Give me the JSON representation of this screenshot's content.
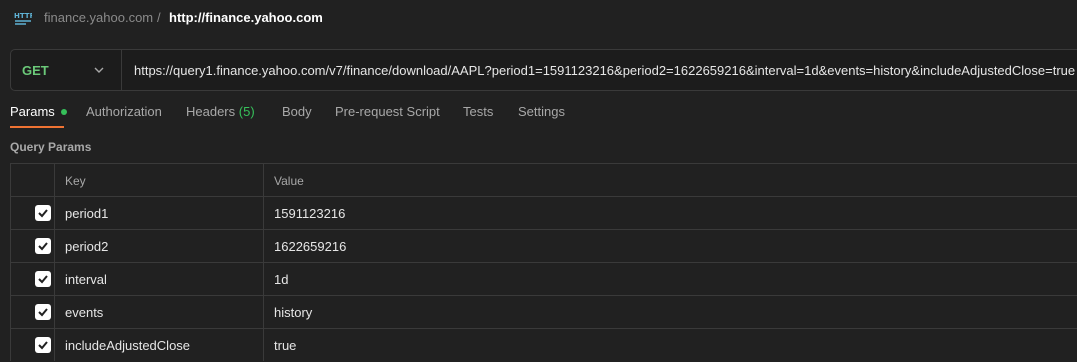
{
  "breadcrumb": {
    "parent": "finance.yahoo.com",
    "separator": "/",
    "current": "http://finance.yahoo.com"
  },
  "request": {
    "method": "GET",
    "url": "https://query1.finance.yahoo.com/v7/finance/download/AAPL?period1=1591123216&period2=1622659216&interval=1d&events=history&includeAdjustedClose=true"
  },
  "tabs": [
    {
      "label": "Params",
      "active": true
    },
    {
      "label": "Authorization"
    },
    {
      "label": "Headers",
      "count": "(5)"
    },
    {
      "label": "Body"
    },
    {
      "label": "Pre-request Script"
    },
    {
      "label": "Tests"
    },
    {
      "label": "Settings"
    }
  ],
  "query_params": {
    "title": "Query Params",
    "columns": {
      "key": "Key",
      "value": "Value"
    },
    "rows": [
      {
        "key": "period1",
        "value": "1591123216",
        "checked": true
      },
      {
        "key": "period2",
        "value": "1622659216",
        "checked": true
      },
      {
        "key": "interval",
        "value": "1d",
        "checked": true
      },
      {
        "key": "events",
        "value": "history",
        "checked": true
      },
      {
        "key": "includeAdjustedClose",
        "value": "true",
        "checked": true
      }
    ]
  },
  "colors": {
    "method_get": "#6bc979",
    "active_dot": "#36c05a",
    "active_underline": "#f07333"
  }
}
